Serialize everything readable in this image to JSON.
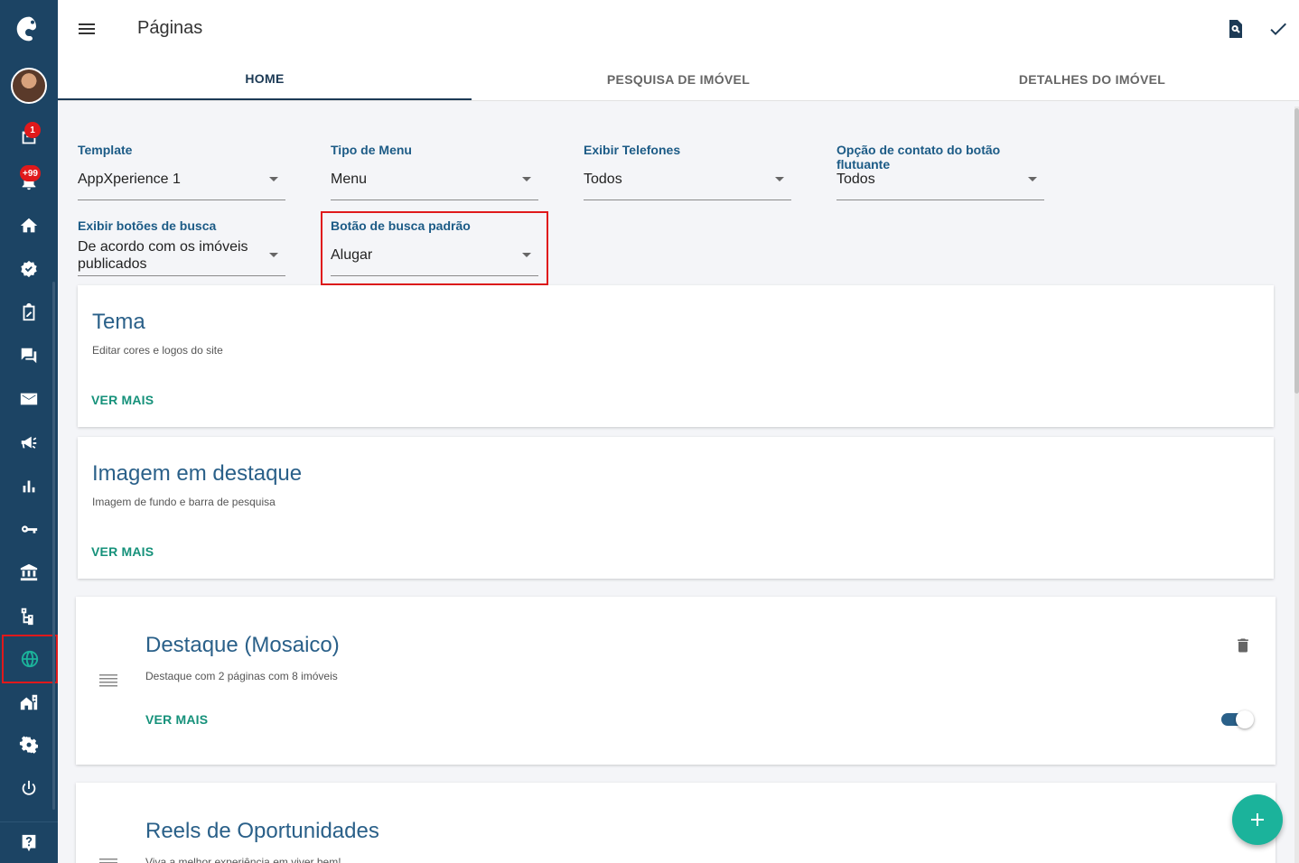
{
  "header": {
    "title": "Páginas"
  },
  "tabs": [
    {
      "label": "HOME",
      "active": true
    },
    {
      "label": "PESQUISA DE IMÓVEL",
      "active": false
    },
    {
      "label": "DETALHES DO IMÓVEL",
      "active": false
    }
  ],
  "sidebar": {
    "badges": {
      "leads": "1",
      "notifications": "+99"
    },
    "icons": [
      "logo-icon",
      "avatar",
      "leads-icon",
      "notifications-icon",
      "home-icon",
      "verified-icon",
      "edit-note-icon",
      "chat-icon",
      "mail-icon",
      "megaphone-icon",
      "bar-chart-icon",
      "key-icon",
      "bank-icon",
      "hierarchy-icon",
      "globe-icon",
      "buildings-icon",
      "gear-icon",
      "power-icon",
      "help-icon"
    ],
    "active": "globe-icon"
  },
  "form": {
    "template": {
      "label": "Template",
      "value": "AppXperience 1"
    },
    "menu_type": {
      "label": "Tipo de Menu",
      "value": "Menu"
    },
    "phones": {
      "label": "Exibir Telefones",
      "value": "Todos"
    },
    "floating_contact": {
      "label": "Opção de contato do botão flutuante",
      "value": "Todos"
    },
    "search_buttons": {
      "label": "Exibir botões de busca",
      "value": "De acordo com os imóveis publicados"
    },
    "default_search": {
      "label": "Botão de busca padrão",
      "value": "Alugar"
    }
  },
  "cards": [
    {
      "title": "Tema",
      "description": "Editar cores e logos do site",
      "link": "VER MAIS"
    },
    {
      "title": "Imagem em destaque",
      "description": "Imagem de fundo e barra de pesquisa",
      "link": "VER MAIS"
    },
    {
      "title": "Destaque (Mosaico)",
      "description": "Destaque com 2 páginas com 8 imóveis",
      "link": "VER MAIS",
      "enabled": true
    },
    {
      "title": "Reels de Oportunidades",
      "description": "Viva a melhor experiência em viver bem!"
    }
  ],
  "colors": {
    "sidebar": "#1c4464",
    "accent": "#1bb39b",
    "title": "#2a6089",
    "link": "#15917a",
    "highlight": "#e0191b"
  }
}
